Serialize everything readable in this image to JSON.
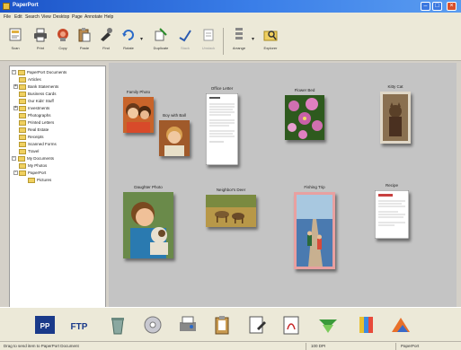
{
  "window": {
    "title": "PaperPort"
  },
  "menu": [
    "File",
    "Edit",
    "Search",
    "View",
    "Desktop",
    "Page",
    "Annotate",
    "Help"
  ],
  "toolbar": {
    "buttons": [
      {
        "label": "Scan",
        "icon": "scan-icon"
      },
      {
        "label": "Print",
        "icon": "print-icon"
      },
      {
        "label": "Copy",
        "icon": "copy-icon"
      },
      {
        "label": "Paste",
        "icon": "paste-icon"
      },
      {
        "label": "Find",
        "icon": "find-icon"
      },
      {
        "label": "Rotate",
        "icon": "rotate-icon"
      },
      {
        "label": "Duplicate",
        "icon": "duplicate-icon"
      },
      {
        "label": "Stack",
        "icon": "stack-icon"
      },
      {
        "label": "Unstack",
        "icon": "unstack-icon"
      },
      {
        "label": "Arrange",
        "icon": "arrange-icon"
      },
      {
        "label": "Explorer",
        "icon": "explorer-icon"
      }
    ]
  },
  "tree": [
    {
      "label": "PaperPort Documents",
      "level": 0
    },
    {
      "label": "Articles",
      "level": 1
    },
    {
      "label": "Bank Statements",
      "level": 1
    },
    {
      "label": "Business Cards",
      "level": 1
    },
    {
      "label": "Our Kids' Stuff",
      "level": 1
    },
    {
      "label": "Investments",
      "level": 1
    },
    {
      "label": "Photographs",
      "level": 1
    },
    {
      "label": "Printed Letters",
      "level": 1
    },
    {
      "label": "Real Estate",
      "level": 1
    },
    {
      "label": "Receipts",
      "level": 1
    },
    {
      "label": "Scanned Forms",
      "level": 1
    },
    {
      "label": "Travel",
      "level": 1
    },
    {
      "label": "My Documents",
      "level": 0
    },
    {
      "label": "My Photos",
      "level": 1
    },
    {
      "label": "PaperPort",
      "level": 1
    },
    {
      "label": "Pictures",
      "level": 2
    }
  ],
  "items": [
    {
      "caption": "Family Photo",
      "kind": "photo-girls"
    },
    {
      "caption": "Boy with Ball",
      "kind": "photo-boy"
    },
    {
      "caption": "Office Letter",
      "kind": "document"
    },
    {
      "caption": "Flower Bed",
      "kind": "photo-flowers"
    },
    {
      "caption": "Kitty Cat",
      "kind": "photo-cat"
    },
    {
      "caption": "Daughter Photo",
      "kind": "photo-girl-dog"
    },
    {
      "caption": "Neighbor's Deer",
      "kind": "photo-deer"
    },
    {
      "caption": "Fishing Trip",
      "kind": "photo-dock"
    },
    {
      "caption": "Recipe",
      "kind": "document-2"
    }
  ],
  "sendto": [
    {
      "label": "PaperPort PDF",
      "icon": "pdf-app-icon"
    },
    {
      "label": "FTP",
      "icon": "ftp-app-icon"
    },
    {
      "label": "Recycle",
      "icon": "recycle-icon"
    },
    {
      "label": "Scanner",
      "icon": "cd-icon"
    },
    {
      "label": "Fax",
      "icon": "fax-icon"
    },
    {
      "label": "Clipboard",
      "icon": "clipboard-icon"
    },
    {
      "label": "Editor",
      "icon": "editor-icon"
    },
    {
      "label": "Acrobat",
      "icon": "acrobat-icon"
    },
    {
      "label": "Mail",
      "icon": "mail-icon"
    },
    {
      "label": "Paint",
      "icon": "paint-icon"
    },
    {
      "label": "Photo",
      "icon": "photo-app-icon"
    }
  ],
  "status": {
    "message": "Drag to send item to PaperPort Document",
    "pane1": "100 DPI",
    "pane2": "PaperPort"
  }
}
